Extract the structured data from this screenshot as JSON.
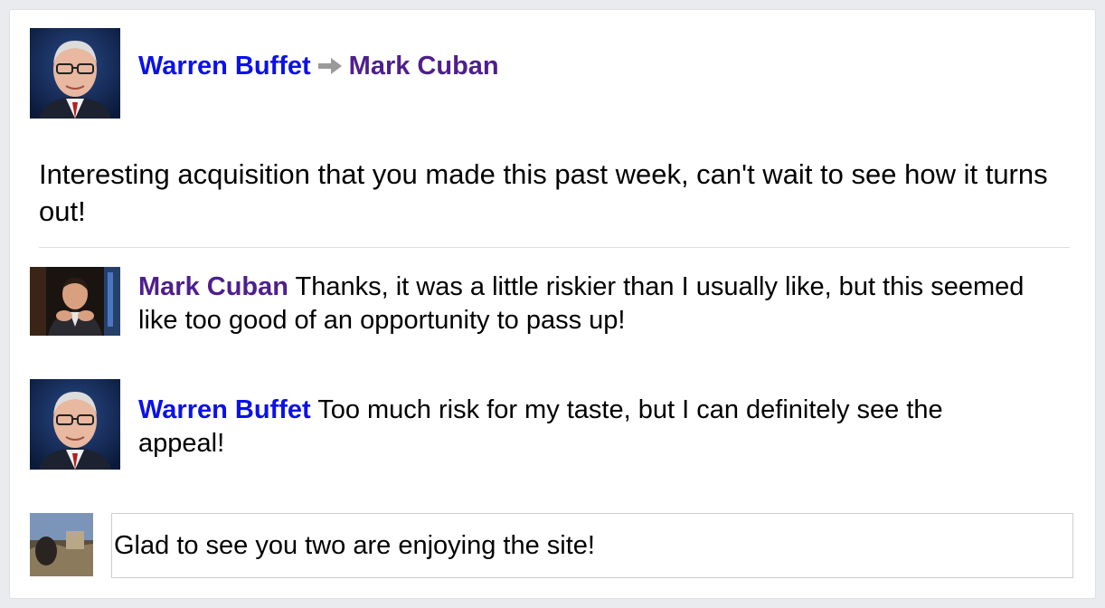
{
  "post": {
    "author": "Warren Buffet",
    "recipient": "Mark Cuban",
    "body": "Interesting acquisition that you made this past week, can't wait to see how it turns out!",
    "header_icons": {
      "author_avatar": "warren-buffet-avatar",
      "arrow": "arrow-right-icon"
    }
  },
  "comments": [
    {
      "author": "Mark Cuban",
      "text": " Thanks, it was a little riskier than I usually like, but this seemed like too good of an opportunity to pass up!",
      "author_color": "#4e1f8c"
    },
    {
      "author": "Warren Buffet",
      "text": " Too much risk for my taste, but I can definitely see the appeal!",
      "author_color": "#0b11e8"
    }
  ],
  "reply": {
    "value": "Glad to see you two are enjoying the site!"
  },
  "colors": {
    "author_link": "#0b11e8",
    "visited_link": "#4e1f8c",
    "arrow": "#9a9a9a",
    "border": "#dddfe2",
    "page_background": "#e9ebee"
  }
}
